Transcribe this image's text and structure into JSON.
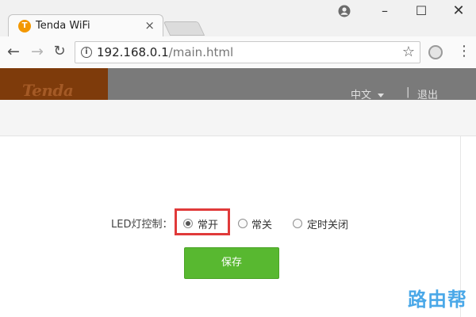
{
  "browser": {
    "tab_title": "Tenda WiFi",
    "tab_close": "×",
    "url_host": "192.168.0.1",
    "url_path": "/main.html",
    "window_controls": {
      "minimize": "–",
      "maximize": "☐",
      "close": "✕"
    },
    "icons": [
      "tenda-favicon-icon",
      "account-icon",
      "back-icon",
      "forward-icon",
      "reload-icon",
      "info-icon",
      "star-icon",
      "extension-icon",
      "menu-icon"
    ]
  },
  "header": {
    "logo": "Tenda",
    "language": "中文",
    "separator": "|",
    "logout": "退出",
    "colors": {
      "logo_bg": "#7e3b0b",
      "bar_bg": "#7a7a7a"
    }
  },
  "led_control": {
    "label": "LED灯控制：",
    "options": [
      {
        "label": "常开",
        "checked": true
      },
      {
        "label": "常关",
        "checked": false
      },
      {
        "label": "定时关闭",
        "checked": false
      }
    ]
  },
  "save_button": {
    "label": "保存",
    "color": "#58b830"
  },
  "highlight_color": "#e03a3a",
  "watermark": "路由帮"
}
